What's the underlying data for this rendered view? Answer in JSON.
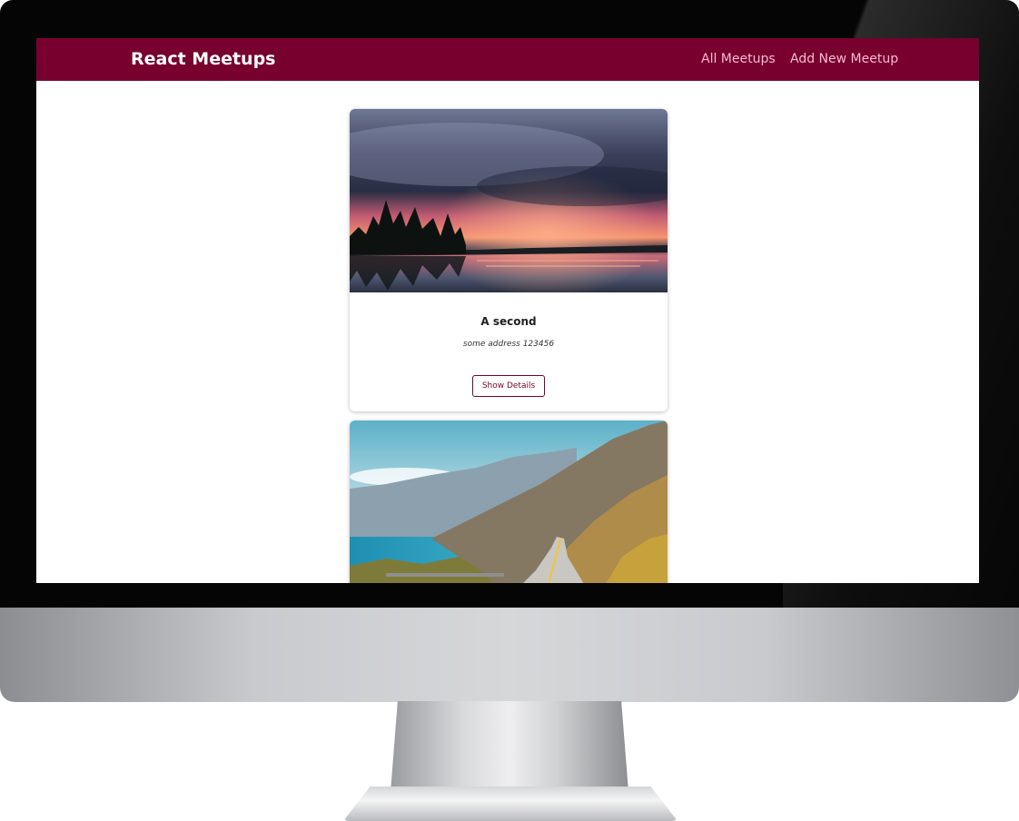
{
  "app": {
    "title": "React Meetups"
  },
  "nav": {
    "items": [
      {
        "label": "All Meetups"
      },
      {
        "label": "Add New Meetup"
      }
    ]
  },
  "meetups": [
    {
      "title": "A second",
      "address": "some address 123456",
      "action_label": "Show Details",
      "image": "sunset-lake-storm-clouds"
    },
    {
      "image": "coastal-mountain-road"
    }
  ],
  "colors": {
    "header_bg": "#77002e",
    "nav_link": "#fcb8d2",
    "button_border": "#77002e"
  }
}
